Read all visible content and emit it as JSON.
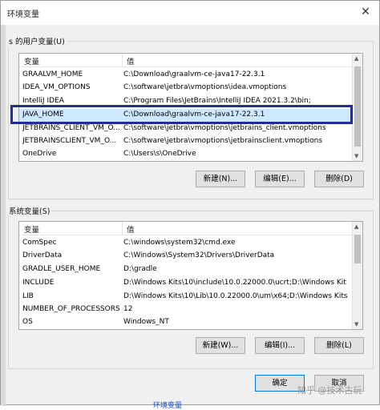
{
  "window": {
    "title": "环境变量",
    "close_glyph": "✕"
  },
  "user_vars": {
    "group_label": "s 的用户变量(U)",
    "headers": [
      "变量",
      "值"
    ],
    "rows": [
      [
        "GRAALVM_HOME",
        "C:\\Download\\graalvm-ce-java17-22.3.1"
      ],
      [
        "IDEA_VM_OPTIONS",
        "C:\\software\\jetbra\\vmoptions\\idea.vmoptions"
      ],
      [
        "IntelliJ IDEA",
        "C:\\Program Files\\JetBrains\\IntelliJ IDEA 2021.3.2\\bin;"
      ],
      [
        "JAVA_HOME",
        "C:\\Download\\graalvm-ce-java17-22.3.1"
      ],
      [
        "JETBRAINS_CLIENT_VM_O...",
        "C:\\software\\jetbra\\vmoptions\\jetbrains_client.vmoptions"
      ],
      [
        "JETBRAINSCLIENT_VM_O...",
        "C:\\software\\jetbra\\vmoptions\\jetbrainsclient.vmoptions"
      ],
      [
        "OneDrive",
        "C:\\Users\\s\\OneDrive"
      ]
    ],
    "buttons": {
      "new": "新建(N)...",
      "edit": "编辑(E)...",
      "delete": "删除(D)"
    }
  },
  "system_vars": {
    "group_label": "系统变量(S)",
    "headers": [
      "变量",
      "值"
    ],
    "rows": [
      [
        "ComSpec",
        "C:\\windows\\system32\\cmd.exe"
      ],
      [
        "DriverData",
        "C:\\Windows\\System32\\Drivers\\DriverData"
      ],
      [
        "GRADLE_USER_HOME",
        "D:\\gradle"
      ],
      [
        "INCLUDE",
        "D:\\Windows Kits\\10\\include\\10.0.22000.0\\ucrt;D:\\Windows Kit"
      ],
      [
        "LIB",
        "D:\\Windows Kits\\10\\Lib\\10.0.22000.0\\um\\x64;D:\\Windows Kits"
      ],
      [
        "NUMBER_OF_PROCESSORS",
        "12"
      ],
      [
        "OS",
        "Windows_NT"
      ]
    ],
    "buttons": {
      "new": "新建(W)...",
      "edit": "编辑(I)...",
      "delete": "删除(L)"
    }
  },
  "dialog_buttons": {
    "ok": "确定",
    "cancel": "取消"
  },
  "watermark": "知乎 @技术古玩",
  "bottom_link": "环境变量"
}
